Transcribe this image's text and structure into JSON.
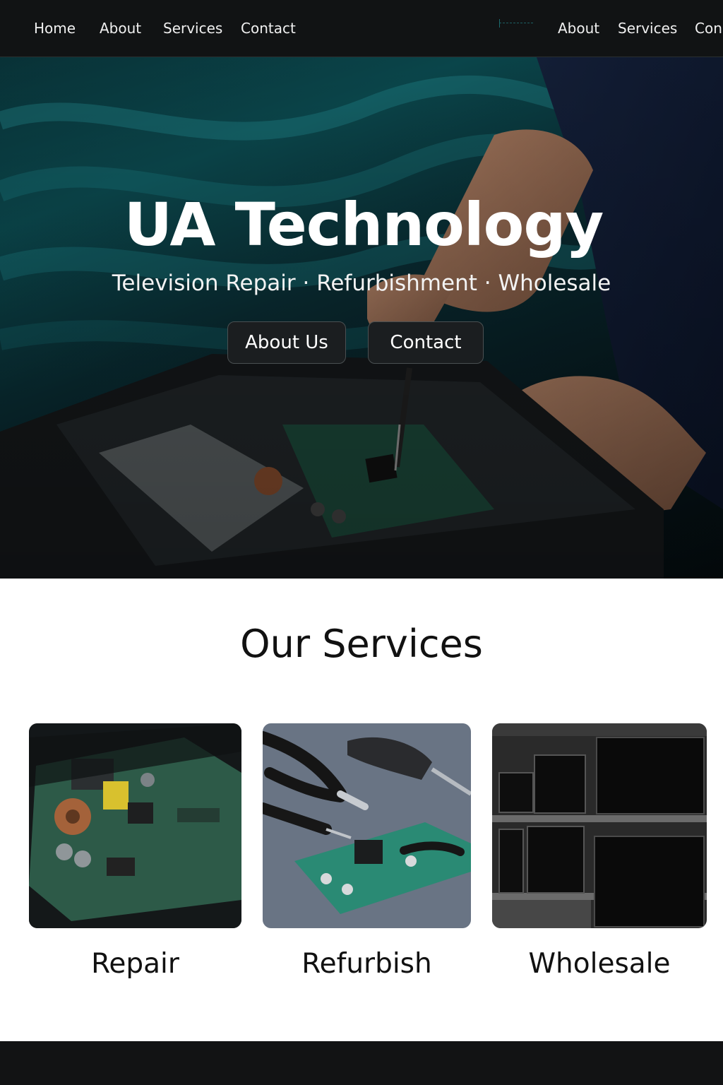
{
  "nav": {
    "left_links": [
      "Home",
      "About",
      "Services",
      "Contact"
    ],
    "right_links": [
      "About",
      "Services",
      "Con"
    ]
  },
  "hero": {
    "title": "UA Technology",
    "subtitle": "Television Repair · Refurbishment · Wholesale",
    "buttons": {
      "about": "About Us",
      "contact": "Contact"
    }
  },
  "services": {
    "title": "Our Services",
    "cards": [
      {
        "label": "Repair",
        "image": "circuit-board-in-tv-chassis"
      },
      {
        "label": "Refurbish",
        "image": "pliers-and-circuit-board"
      },
      {
        "label": "Wholesale",
        "image": "tv-display-shelves"
      }
    ]
  },
  "colors": {
    "nav_bg": "#111314",
    "hero_teal": "#0c5157",
    "button_bg": "#1b1e20",
    "footer_bg": "#121314"
  }
}
